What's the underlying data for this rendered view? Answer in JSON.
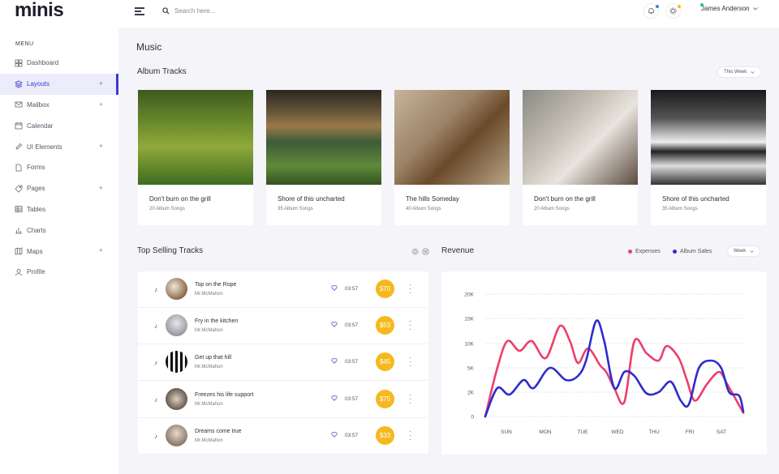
{
  "app": {
    "logo": "minis"
  },
  "header": {
    "search_placeholder": "Search here...",
    "user_name": "James Anderson",
    "bell_dot_color": "#3b82f6",
    "settings_dot_color": "#f5b91e"
  },
  "sidebar": {
    "menu_title": "MENU",
    "items": [
      {
        "label": "Dashboard",
        "icon": "grid-icon",
        "has_plus": false,
        "active": false
      },
      {
        "label": "Layouts",
        "icon": "layers-icon",
        "has_plus": true,
        "active": true
      },
      {
        "label": "Mailbox",
        "icon": "mail-icon",
        "has_plus": true,
        "active": false
      },
      {
        "label": "Calendar",
        "icon": "calendar-icon",
        "has_plus": false,
        "active": false
      },
      {
        "label": "UI Elements",
        "icon": "pen-icon",
        "has_plus": true,
        "active": false
      },
      {
        "label": "Forms",
        "icon": "file-icon",
        "has_plus": false,
        "active": false
      },
      {
        "label": "Pages",
        "icon": "tag-icon",
        "has_plus": true,
        "active": false
      },
      {
        "label": "Tables",
        "icon": "table-icon",
        "has_plus": false,
        "active": false
      },
      {
        "label": "Charts",
        "icon": "bar-chart-icon",
        "has_plus": false,
        "active": false
      },
      {
        "label": "Maps",
        "icon": "map-icon",
        "has_plus": true,
        "active": false
      },
      {
        "label": "Profile",
        "icon": "user-icon",
        "has_plus": false,
        "active": false
      }
    ]
  },
  "main": {
    "page_title": "Music",
    "albums_title": "Album Tracks",
    "albums_filter": "This Week",
    "albums": [
      {
        "name": "Don't burn on the grill",
        "songs": "20 Album Songs"
      },
      {
        "name": "Shore of this uncharted",
        "songs": "35 Album Songs"
      },
      {
        "name": "The hills Someday",
        "songs": "40 Album Songs"
      },
      {
        "name": "Don't burn on the grill",
        "songs": "20 Album Songs"
      },
      {
        "name": "Shore of this uncharted",
        "songs": "35 Album Songs"
      }
    ],
    "top_tracks_title": "Top Selling Tracks",
    "tracks": [
      {
        "name": "Top on the Rope",
        "artist": "Mr.McMahon",
        "duration": "03:57",
        "price": "$70"
      },
      {
        "name": "Fry in the kitchen",
        "artist": "Mr.McMahon",
        "duration": "03:57",
        "price": "$53"
      },
      {
        "name": "Get up that hill",
        "artist": "Mr.McMahon",
        "duration": "03:57",
        "price": "$45"
      },
      {
        "name": "Freezes his life support",
        "artist": "Mr.McMahon",
        "duration": "03:57",
        "price": "$75"
      },
      {
        "name": "Dreams come true",
        "artist": "Mr.McMahon",
        "duration": "03:57",
        "price": "$33"
      }
    ],
    "revenue_title": "Revenue",
    "revenue_filter": "Week"
  },
  "chart_data": {
    "type": "line",
    "x": [
      "SUN",
      "MON",
      "TUE",
      "WED",
      "THU",
      "FRI",
      "SAT"
    ],
    "yticks": [
      "0",
      "2K",
      "5K",
      "10K",
      "15K",
      "20K"
    ],
    "ylim": [
      0,
      20000
    ],
    "grid": true,
    "legend_position": "top-right",
    "series": [
      {
        "name": "Expenses",
        "color": "#ee3f6a",
        "points": [
          [
            0.0,
            0
          ],
          [
            0.3,
            5000
          ],
          [
            0.55,
            10500
          ],
          [
            0.85,
            8500
          ],
          [
            1.15,
            10500
          ],
          [
            1.5,
            7000
          ],
          [
            1.85,
            13500
          ],
          [
            2.1,
            10500
          ],
          [
            2.3,
            6000
          ],
          [
            2.55,
            9000
          ],
          [
            2.85,
            5500
          ],
          [
            3.0,
            4500
          ],
          [
            3.2,
            2500
          ],
          [
            3.45,
            1200
          ],
          [
            3.7,
            10500
          ],
          [
            4.0,
            8000
          ],
          [
            4.3,
            6500
          ],
          [
            4.5,
            9500
          ],
          [
            4.8,
            7000
          ],
          [
            5.0,
            3500
          ],
          [
            5.2,
            1300
          ],
          [
            5.5,
            3000
          ],
          [
            5.8,
            4500
          ],
          [
            6.0,
            3000
          ],
          [
            6.2,
            1500
          ],
          [
            6.4,
            300
          ]
        ]
      },
      {
        "name": "Album Sales",
        "color": "#2e2ccd",
        "points": [
          [
            0.0,
            0
          ],
          [
            0.3,
            2500
          ],
          [
            0.6,
            1800
          ],
          [
            0.95,
            3500
          ],
          [
            1.2,
            2500
          ],
          [
            1.6,
            5000
          ],
          [
            2.0,
            3500
          ],
          [
            2.3,
            4000
          ],
          [
            2.5,
            6500
          ],
          [
            2.75,
            14500
          ],
          [
            2.95,
            10500
          ],
          [
            3.2,
            2500
          ],
          [
            3.45,
            4500
          ],
          [
            3.7,
            4000
          ],
          [
            4.0,
            1900
          ],
          [
            4.3,
            2000
          ],
          [
            4.6,
            3300
          ],
          [
            4.85,
            1300
          ],
          [
            5.05,
            1000
          ],
          [
            5.3,
            5000
          ],
          [
            5.6,
            6500
          ],
          [
            5.85,
            5000
          ],
          [
            6.05,
            2000
          ],
          [
            6.3,
            1700
          ],
          [
            6.4,
            400
          ]
        ]
      }
    ]
  }
}
